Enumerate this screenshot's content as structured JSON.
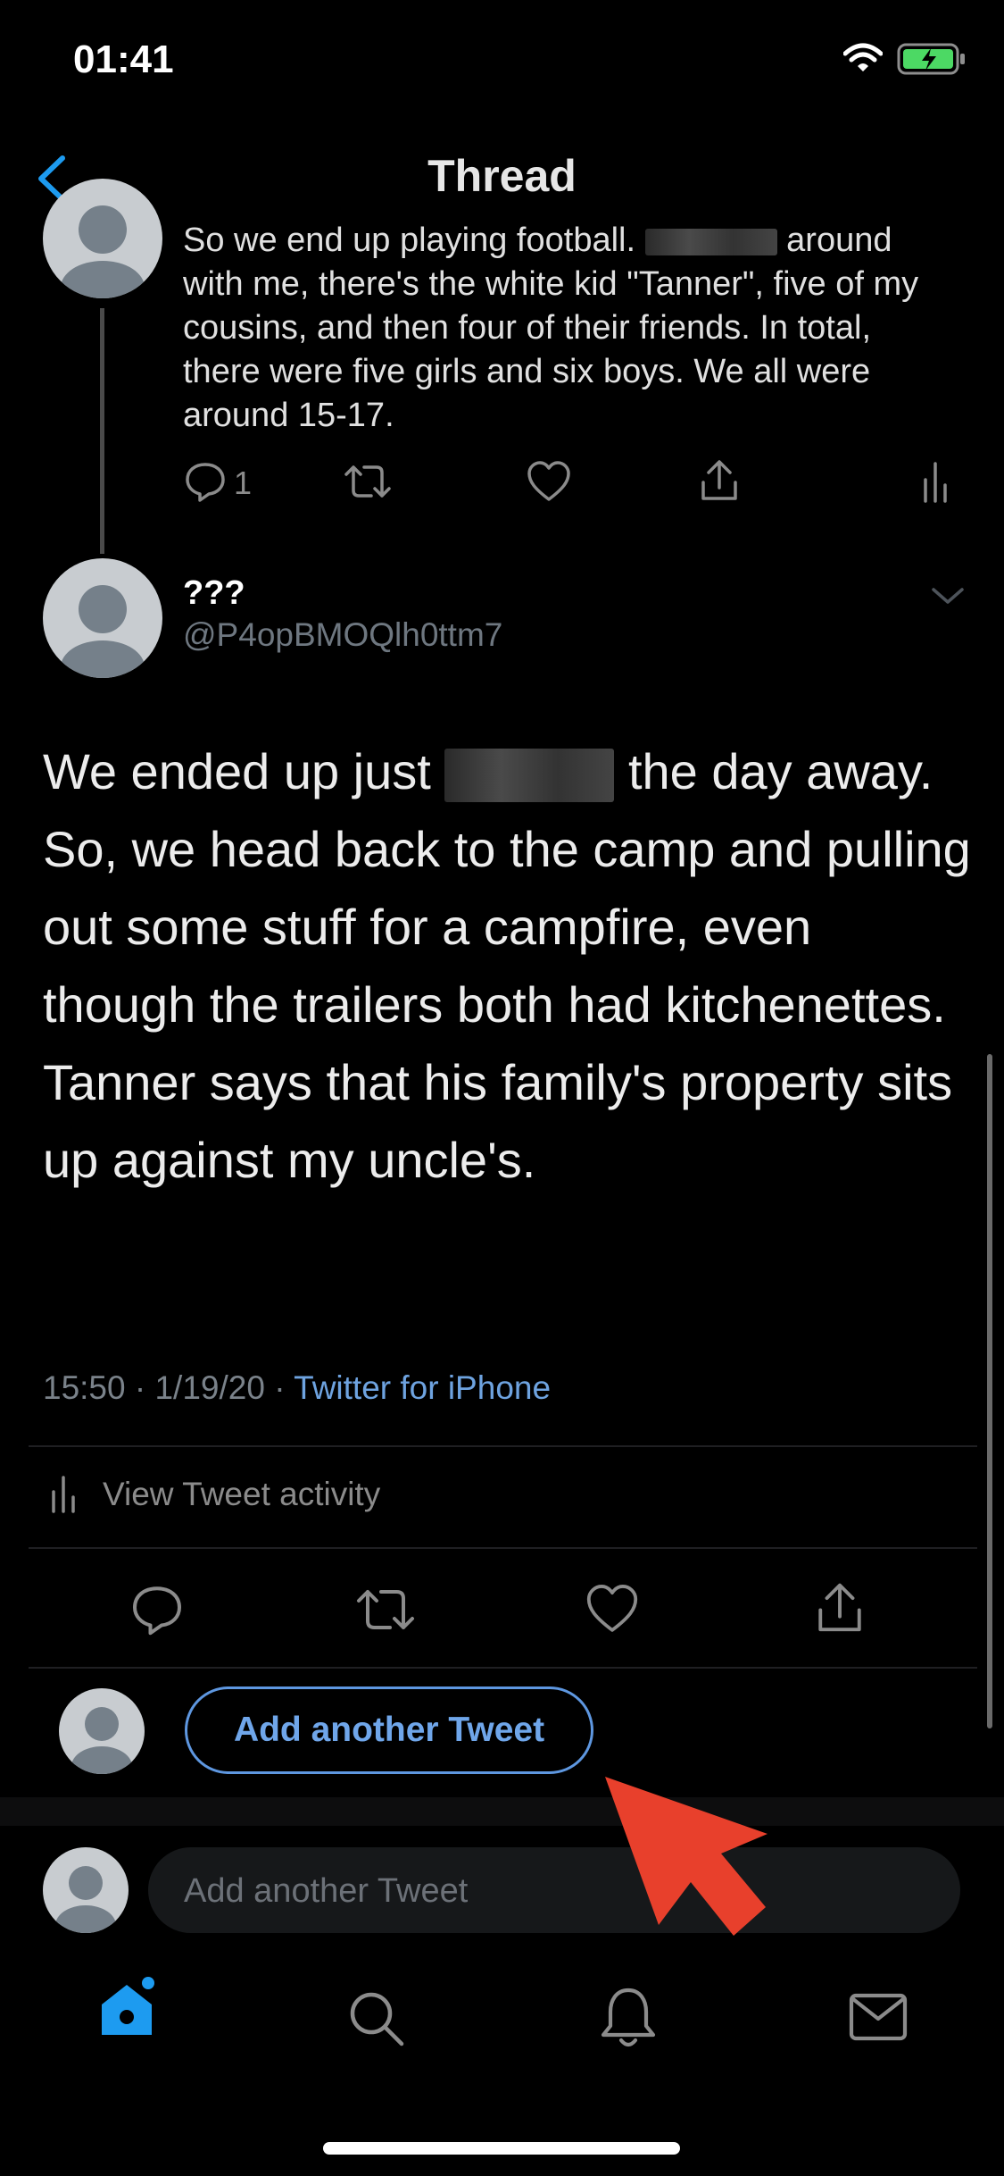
{
  "status_bar": {
    "time": "01:41"
  },
  "header": {
    "title": "Thread"
  },
  "prev_tweet": {
    "line1_a": "So we end up playing football.",
    "line1_b": "around",
    "rest": "with me, there's the white kid \"Tanner\", five of my cousins, and then four of their friends. In total, there were five girls and six boys. We all were around 15-17.",
    "reply_count": "1"
  },
  "tweet": {
    "name": "???",
    "handle": "@P4opBMOQlh0ttm7",
    "text_a": "We ended up just",
    "text_b": "the day away. So, we head back to the camp and pulling out some stuff for a campfire, even though the trailers both had kitchenettes. Tanner says that his family's property sits up against my uncle's.",
    "timestamp": "15:50 · 1/19/20 · ",
    "source": "Twitter for iPhone",
    "activity_label": "View Tweet activity"
  },
  "actions": {
    "add_tweet_button": "Add another Tweet",
    "compose_placeholder": "Add another Tweet"
  },
  "colors": {
    "accent": "#1d9bf0",
    "link": "#6ea3e0",
    "arrow": "#e8402c"
  },
  "icons": [
    "back-icon",
    "reply-icon",
    "retweet-icon",
    "like-icon",
    "share-icon",
    "stats-icon",
    "caret-down-icon",
    "home-icon",
    "search-icon",
    "notifications-icon",
    "messages-icon",
    "wifi-icon",
    "battery-icon"
  ]
}
